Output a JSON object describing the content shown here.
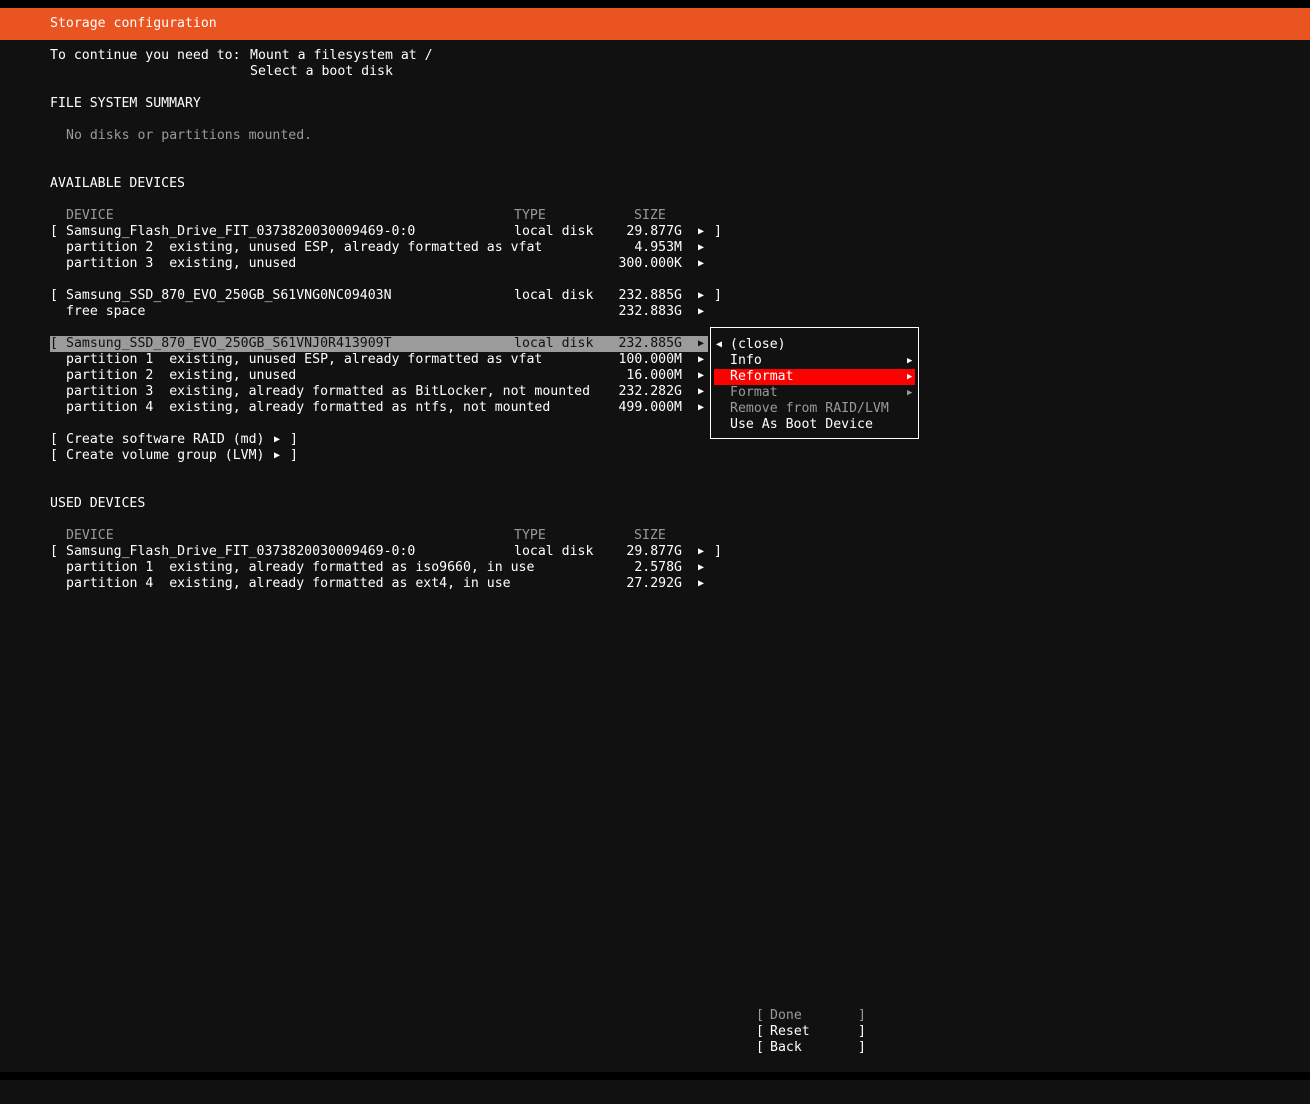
{
  "title": "Storage configuration",
  "requirements": {
    "prefix": "To continue you need to:",
    "items": [
      "Mount a filesystem at /",
      "Select a boot disk"
    ]
  },
  "fs_summary": {
    "heading": "FILE SYSTEM SUMMARY",
    "empty": "No disks or partitions mounted."
  },
  "available": {
    "heading": "AVAILABLE DEVICES",
    "col_device": "DEVICE",
    "col_type": "TYPE",
    "col_size": "SIZE",
    "disk1": {
      "name": "Samsung_Flash_Drive_FIT_0373820030009469-0:0",
      "type": "local disk",
      "size": "29.877G",
      "rows": [
        {
          "name": "partition 2  existing, unused ESP, already formatted as vfat",
          "size": "4.953M"
        },
        {
          "name": "partition 3  existing, unused",
          "size": "300.000K"
        }
      ]
    },
    "disk2": {
      "name": "Samsung_SSD_870_EVO_250GB_S61VNG0NC09403N",
      "type": "local disk",
      "size": "232.885G",
      "rows": [
        {
          "name": "free space",
          "size": "232.883G"
        }
      ]
    },
    "disk3": {
      "name": "Samsung_SSD_870_EVO_250GB_S61VNJ0R413909T",
      "type": "local disk",
      "size": "232.885G",
      "rows": [
        {
          "name": "partition 1  existing, unused ESP, already formatted as vfat",
          "size": "100.000M"
        },
        {
          "name": "partition 2  existing, unused",
          "size": "16.000M"
        },
        {
          "name": "partition 3  existing, already formatted as BitLocker, not mounted",
          "size": "232.282G"
        },
        {
          "name": "partition 4  existing, already formatted as ntfs, not mounted",
          "size": "499.000M"
        }
      ]
    },
    "create_raid": "Create software RAID (md)",
    "create_lvm": "Create volume group (LVM)"
  },
  "used": {
    "heading": "USED DEVICES",
    "col_device": "DEVICE",
    "col_type": "TYPE",
    "col_size": "SIZE",
    "disk1": {
      "name": "Samsung_Flash_Drive_FIT_0373820030009469-0:0",
      "type": "local disk",
      "size": "29.877G",
      "rows": [
        {
          "name": "partition 1  existing, already formatted as iso9660, in use",
          "size": "2.578G"
        },
        {
          "name": "partition 4  existing, already formatted as ext4, in use",
          "size": "27.292G"
        }
      ]
    }
  },
  "context_menu": {
    "close": "(close)",
    "info": "Info",
    "reformat": "Reformat",
    "format": "Format",
    "remove": "Remove from RAID/LVM",
    "boot": "Use As Boot Device"
  },
  "buttons": {
    "done": "Done",
    "reset": "Reset",
    "back": "Back"
  },
  "glyphs": {
    "bracket_open": "[",
    "bracket_close": "]",
    "arrow_right": "▶",
    "arrow_left": "◀"
  },
  "colors": {
    "accent": "#e95420",
    "selection": "#ff0000",
    "highlight": "#9b9b9b",
    "background": "#111111"
  }
}
